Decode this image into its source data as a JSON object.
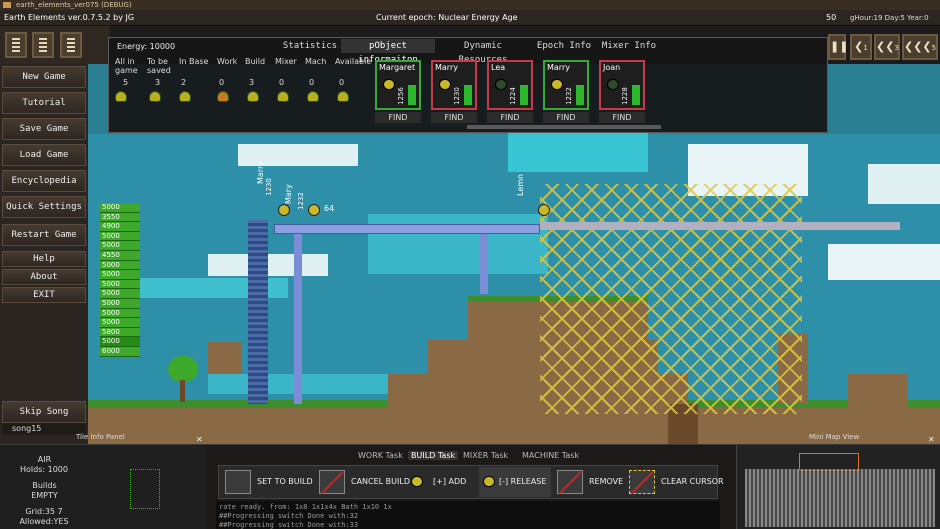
{
  "window": {
    "title": "earth_elements_ver075 (DEBUG)"
  },
  "topbar": {
    "game_title": "Earth Elements ver.0.7.5.2 by JG",
    "epoch": "Current epoch: Nuclear Energy Age",
    "count": "50",
    "date": "gHour:19 Day:5 Year:0"
  },
  "menu": {
    "items": [
      "New Game",
      "Tutorial",
      "Save Game",
      "Load Game",
      "Encyclopedia",
      "Quick Settings",
      "Restart Game"
    ],
    "small_items": [
      "Help",
      "About",
      "EXIT"
    ],
    "skip_song": "Skip Song",
    "song": "song15"
  },
  "speed_controls": {
    "speed_1": "1",
    "speed_3": "3",
    "speed_5": "5"
  },
  "info_panel": {
    "energy": "Energy: 10000",
    "tabs": [
      "Statistics",
      "pObject informaiton",
      "Dynamic Resources",
      "Epoch Info",
      "Mixer Info"
    ],
    "active_tab": 1,
    "columns": [
      {
        "label": "All in game",
        "value": "5"
      },
      {
        "label": "To be saved",
        "value": "3"
      },
      {
        "label": "In Base",
        "value": "2"
      },
      {
        "label": "Work",
        "value": "0"
      },
      {
        "label": "Build",
        "value": "3"
      },
      {
        "label": "Mixer",
        "value": "0"
      },
      {
        "label": "Mach",
        "value": "0"
      },
      {
        "label": "Available",
        "value": "0"
      }
    ],
    "characters": [
      {
        "name": "Margaret",
        "value": "1256",
        "border": "#3aa83a"
      },
      {
        "name": "Marry",
        "value": "1230",
        "border": "#c83a4a"
      },
      {
        "name": "Lea",
        "value": "1224",
        "border": "#c83a4a"
      },
      {
        "name": "Marry",
        "value": "1232",
        "border": "#3aa83a"
      },
      {
        "name": "Joan",
        "value": "1228",
        "border": "#c83a4a"
      }
    ],
    "find_label": "FIND"
  },
  "world": {
    "labels": {
      "marry": "Marry",
      "mary": "Mary",
      "lemn": "Lemn",
      "count": "64",
      "v1230": "1230",
      "v1232": "1232"
    },
    "depths": [
      "5000",
      "3550",
      "4900",
      "5000",
      "5000",
      "4550",
      "5000",
      "5000",
      "5000",
      "5000",
      "5000",
      "5000",
      "5000",
      "5800",
      "5000",
      "6000"
    ]
  },
  "tile_info": {
    "header": "Tile Info Panel",
    "element": "AIR",
    "holds": "Holds: 1000",
    "builds_label": "Builds",
    "builds_value": "EMPTY",
    "grid": "Grid:35 7",
    "allowed": "Allowed:YES"
  },
  "tasks": {
    "tabs": [
      "WORK Task",
      "BUILD Task",
      "MIXER Task",
      "MACHINE Task"
    ],
    "active": 1,
    "tools": [
      "SET TO BUILD",
      "CANCEL BUILD",
      "[+] ADD",
      "[-] RELEASE",
      "REMOVE",
      "CLEAR CURSOR"
    ]
  },
  "console_lines": [
    "rate ready. from: 1x8 1x1x4x Bath  1x10 1x",
    "##Progressing switch Done with:32",
    "##Progressing switch Done with:33"
  ],
  "minimap": {
    "header": "Mini Map View"
  }
}
